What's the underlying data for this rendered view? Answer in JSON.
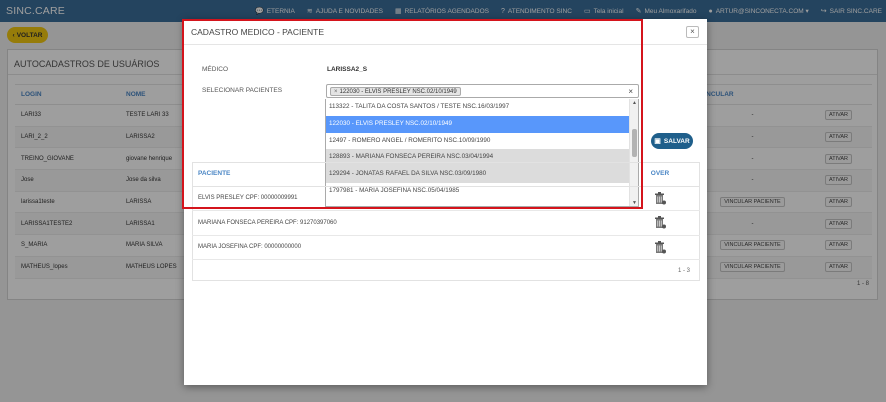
{
  "app": {
    "brand": "SINC.CARE"
  },
  "topnav": [
    {
      "icon": "chat-icon",
      "glyph": "💬",
      "label": "ETERNIA"
    },
    {
      "icon": "rss-icon",
      "glyph": "≋",
      "label": "AJUDA E NOVIDADES"
    },
    {
      "icon": "calendar-icon",
      "glyph": "▦",
      "label": "RELATÓRIOS AGENDADOS"
    },
    {
      "icon": "question-icon",
      "glyph": "?",
      "label": "ATENDIMENTO SINC"
    },
    {
      "icon": "screen-icon",
      "glyph": "▭",
      "label": "Tela inicial"
    },
    {
      "icon": "edit-icon",
      "glyph": "✎",
      "label": "Meu Almoxarifado"
    },
    {
      "icon": "user-icon",
      "glyph": "●",
      "label": "ARTUR@SINCONECTA.COM ▾"
    },
    {
      "icon": "logout-icon",
      "glyph": "↪",
      "label": "SAIR SINC.CARE"
    }
  ],
  "page": {
    "back_label": "VOLTAR",
    "panel_title": "AUTOCADASTROS DE USUÁRIOS",
    "columns": {
      "login": "LOGIN",
      "nome": "NOME",
      "vincular": "VINCULAR"
    },
    "rows": [
      {
        "login": "LARI33",
        "nome": "TESTE LARI 33",
        "vincular": "-",
        "acao": "ATIVAR"
      },
      {
        "login": "LARI_2_2",
        "nome": "LARISSA2",
        "vincular": "-",
        "acao": "ATIVAR"
      },
      {
        "login": "TREINO_GIOVANE",
        "nome": "giovane henrique",
        "vincular": "-",
        "acao": "ATIVAR"
      },
      {
        "login": "Jose",
        "nome": "Jose da silva",
        "vincular": "-",
        "acao": "ATIVAR"
      },
      {
        "login": "larissa1teste",
        "nome": "LARISSA",
        "vincular": "VINCULAR PACIENTE",
        "acao": "ATIVAR"
      },
      {
        "login": "LARISSA1TESTE2",
        "nome": "LARISSA1",
        "vincular": "-",
        "acao": "ATIVAR"
      },
      {
        "login": "S_MARIA",
        "nome": "MARIA SILVA",
        "vincular": "VINCULAR PACIENTE",
        "acao": "ATIVAR"
      },
      {
        "login": "MATHEUS_lopes",
        "nome": "MATHEUS LOPES",
        "vincular": "VINCULAR PACIENTE",
        "acao": "ATIVAR"
      }
    ],
    "pagination": "1 - 8"
  },
  "modal": {
    "title": "CADASTRO MEDICO - PACIENTE",
    "close": "×",
    "medico_label": "MÉDICO",
    "medico_value": "LARISSA2_S",
    "select_label": "SELECIONAR PACIENTES",
    "selected_tag": "122030 - ELVIS PRESLEY NSC.02/10/1949",
    "options": [
      "113322 - TALITA DA COSTA SANTOS / TESTE NSC.16/03/1997",
      "122030 - ELVIS PRESLEY NSC.02/10/1949",
      "12497 - ROMERO ANGEL / ROMERITO NSC.10/09/1990",
      "128893 - MARIANA FONSECA PEREIRA NSC.03/04/1994",
      "129294 - JONATAS RAFAEL DA SILVA NSC.03/09/1980",
      "1797981 - MARIA JOSEFINA NSC.05/04/1985"
    ],
    "save_label": "SALVAR",
    "table": {
      "col_paciente": "PACIENTE",
      "col_remover": "OVER",
      "rows": [
        "ELVIS PRESLEY CPF: 00000009991",
        "MARIANA FONSECA PEREIRA CPF: 91270397060",
        "MARIA JOSEFINA CPF: 00000000000"
      ]
    },
    "pagination": "1 - 3"
  }
}
